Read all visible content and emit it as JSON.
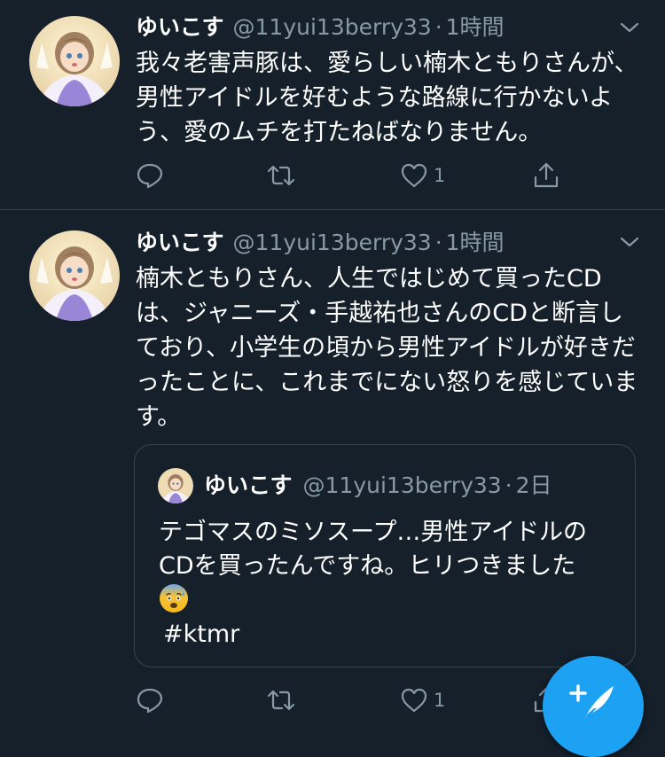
{
  "tweets": [
    {
      "user_name": "ゆいこす",
      "handle": "@11yui13berry33",
      "separator": "·",
      "time": "1時間",
      "text": "我々老害声豚は、愛らしい楠木ともりさんが、男性アイドルを好むような路線に行かないよう、愛のムチを打たねばなりません。",
      "icons": [
        "reply-icon",
        "retweet-icon",
        "like-icon",
        "share-icon"
      ],
      "like_count": "1"
    },
    {
      "user_name": "ゆいこす",
      "handle": "@11yui13berry33",
      "separator": "·",
      "time": "1時間",
      "text": "楠木ともりさん、人生ではじめて買ったCDは、ジャニーズ・手越祐也さんのCDと断言しており、小学生の頃から男性アイドルが好きだったことに、これまでにない怒りを感じています。",
      "quote": {
        "user_name": "ゆいこす",
        "handle": "@11yui13berry33",
        "separator": "·",
        "time": "2日",
        "text": "テゴマスのミソスープ…男性アイドルのCDを買ったんですね。ヒリつきました",
        "emoji": "anxious-face-with-sweat",
        "hashtag": "#ktmr"
      },
      "icons": [
        "reply-icon",
        "retweet-icon",
        "like-icon",
        "share-icon"
      ],
      "like_count": "1"
    }
  ],
  "compose_button": {
    "icon": "compose-tweet-icon"
  },
  "colors": {
    "background": "#15202b",
    "divider": "#38444d",
    "secondary_text": "#8899a6",
    "accent": "#1da1f2"
  }
}
